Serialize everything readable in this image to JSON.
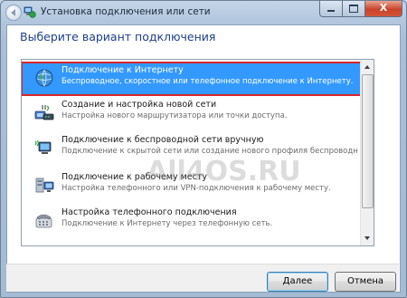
{
  "window": {
    "title": "Установка подключения или сети",
    "close_glyph": "X"
  },
  "main": {
    "heading": "Выберите вариант подключения"
  },
  "options": [
    {
      "title": "Подключение к Интернету",
      "desc": "Беспроводное, скоростное или телефонное подключение к Интернету.",
      "icon": "globe-network-icon",
      "selected": true
    },
    {
      "title": "Создание и настройка новой сети",
      "desc": "Настройка нового маршрутизатора или точки доступа.",
      "icon": "router-icon",
      "selected": false
    },
    {
      "title": "Подключение к беспроводной сети вручную",
      "desc": "Подключение к скрытой сети или создание нового профиля беспроводной связи.",
      "icon": "wireless-computer-icon",
      "selected": false
    },
    {
      "title": "Подключение к рабочему месту",
      "desc": "Настройка телефонного или VPN-подключения к рабочему месту.",
      "icon": "workplace-network-icon",
      "selected": false
    },
    {
      "title": "Настройка телефонного подключения",
      "desc": "Подключение к Интернету через телефонную сеть.",
      "icon": "phone-modem-icon",
      "selected": false
    }
  ],
  "watermark": "All4OS.RU",
  "buttons": {
    "next": "Далее",
    "cancel": "Отмена"
  },
  "colors": {
    "selection": "#3399ff",
    "highlight_border": "#d9262b",
    "heading": "#1e3f8a"
  }
}
